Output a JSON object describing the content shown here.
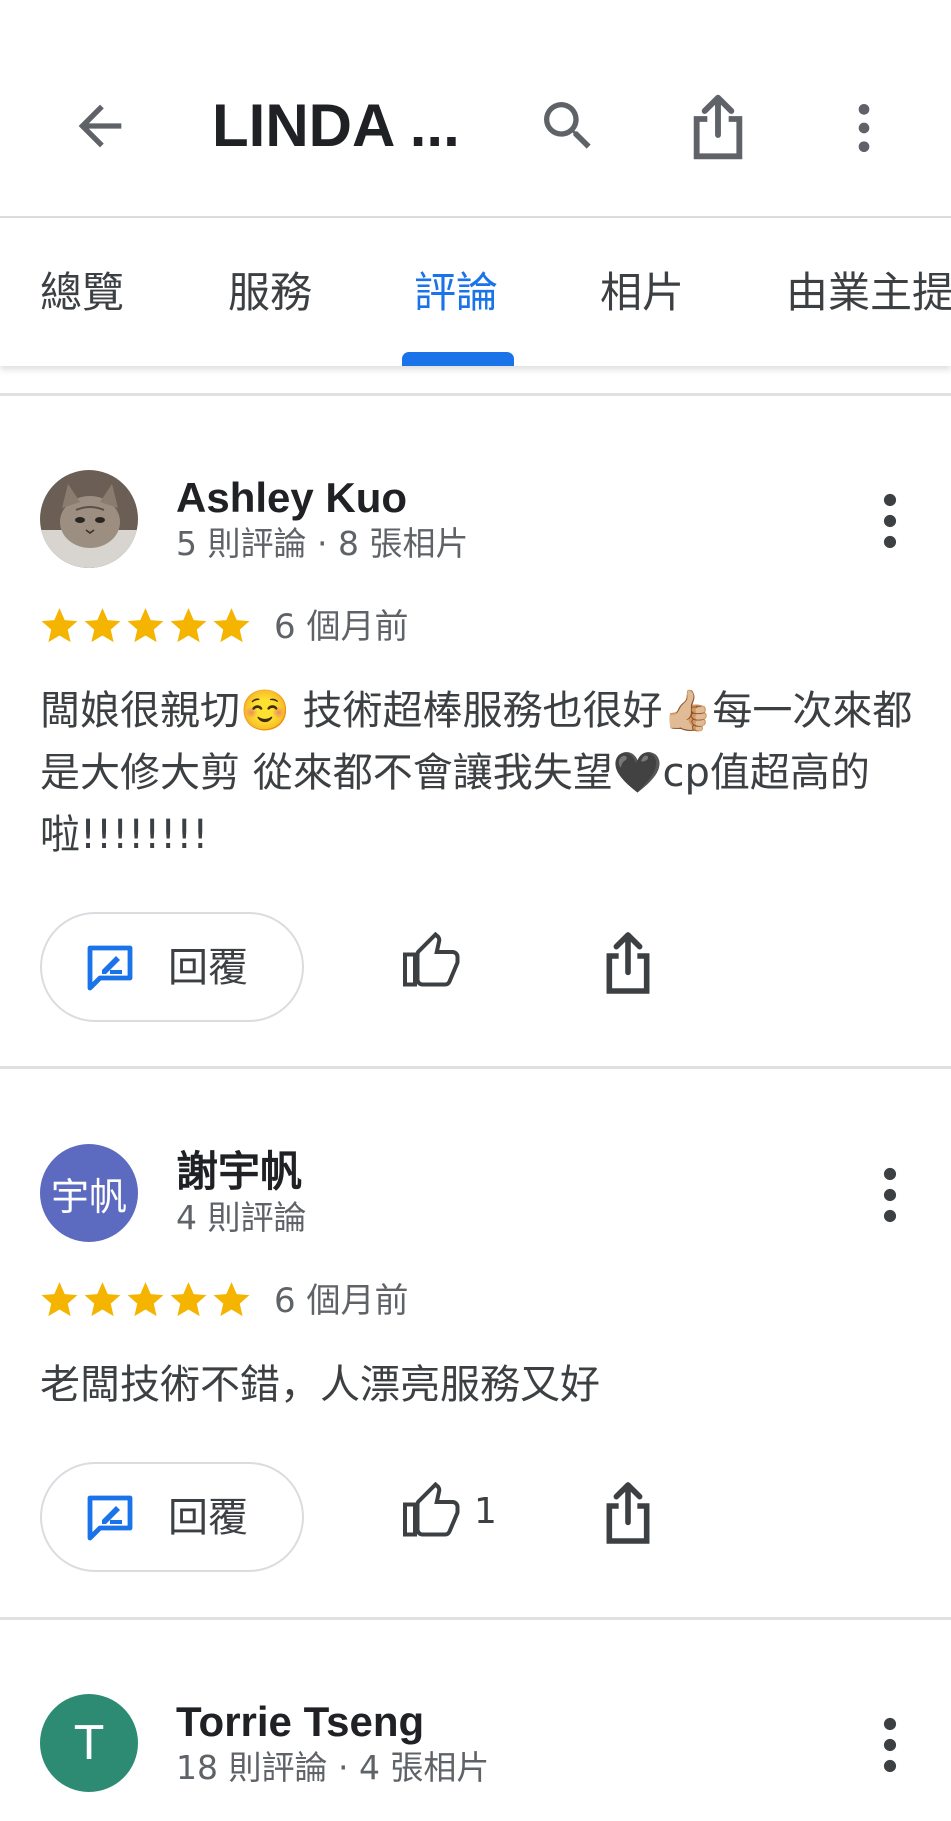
{
  "header": {
    "title": "LINDA ..."
  },
  "tabs": [
    {
      "label": "總覽"
    },
    {
      "label": "服務"
    },
    {
      "label": "評論"
    },
    {
      "label": "相片"
    },
    {
      "label": "由業主提"
    }
  ],
  "colors": {
    "accent": "#1a73e8",
    "star": "#f4b400",
    "avatar_purple": "#5c6bc0",
    "avatar_teal": "#2e8b73"
  },
  "reviews": [
    {
      "name": "Ashley Kuo",
      "meta": "5 則評論 · 8 張相片",
      "avatar": "cat-photo",
      "rating": 5,
      "time": "6 個月前",
      "text": "闆娘很親切☺️ 技術超棒服務也很好👍🏼每一次來都是大修大剪 從來都不會讓我失望🖤cp值超高的啦!!!!!!!!",
      "reply_label": "回覆",
      "likes": ""
    },
    {
      "name": "謝宇帆",
      "meta": "4 則評論",
      "avatar_text": "宇帆",
      "rating": 5,
      "time": "6 個月前",
      "text": "老闆技術不錯，人漂亮服務又好",
      "reply_label": "回覆",
      "likes": "1"
    },
    {
      "name": "Torrie Tseng",
      "meta": "18 則評論 · 4 張相片",
      "avatar_text": "T"
    }
  ]
}
